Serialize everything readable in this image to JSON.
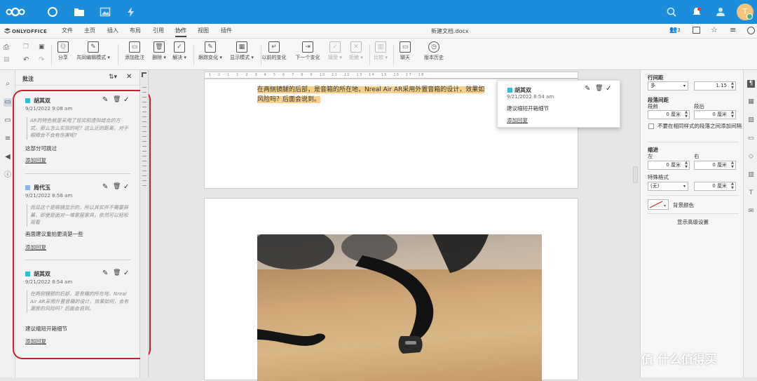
{
  "nextcloud": {
    "icons": [
      "nextcloud-logo",
      "dashboard-icon",
      "files-icon",
      "photos-icon",
      "activity-icon",
      "search-icon",
      "notifications-icon",
      "contacts-icon"
    ],
    "avatar_letter": "T"
  },
  "app": {
    "brand": "ONLYOFFICE",
    "doc_title": "新建文档.docx",
    "tabs": [
      "文件",
      "主页",
      "插入",
      "布局",
      "引用",
      "协作",
      "视图",
      "插件"
    ],
    "active_tab": "协作",
    "header_right": {
      "users_count": "3"
    }
  },
  "toolbar": {
    "share": "分享",
    "coedit": "共同编辑模式",
    "add_comment": "添加批注",
    "delete": "删除",
    "resolve": "解决",
    "track_changes": "跟踪变化",
    "display_mode": "显示模式",
    "prev_change": "以前的变化",
    "next_change": "下一个变化",
    "accept": "接受",
    "reject": "拒绝",
    "compare": "比较",
    "chat": "聊天",
    "version_history": "版本历史"
  },
  "comments_panel": {
    "title": "批注",
    "comments": [
      {
        "author": "胡其双",
        "date": "9/21/2022 9:08 am",
        "color": "#2cc0d0",
        "quote": "AR的特色就是采用了现实和虚拟结合的方式。那么怎么实现的呢？这么近的距离，对于眼睛会不会有伤害呢?",
        "text": "这部分可跳过",
        "reply": "添加回复"
      },
      {
        "author": "周代玉",
        "date": "9/21/2022 8:58 am",
        "color": "#8ab8e6",
        "quote": "而且这个是眼镜显示的，所以其实并不需要屏幕，即使是面对一堆家居家具，依然可以轻松观看",
        "text": "画面建议重拍更清楚一些",
        "reply": "添加回复"
      },
      {
        "author": "胡其双",
        "date": "9/21/2022 8:54 am",
        "color": "#2cc0d0",
        "quote": "在两侧镜腿的后部，是音箱的所在地，Nreal Air AR采用外置音箱的设计，效果如何，会有漏音的风险吗？后面会说到。",
        "text": "建议缩短开箱细节",
        "reply": "添加回复"
      }
    ]
  },
  "document": {
    "highlight_line1": "在两侧镜腿的后部，是音箱的所在地，Nreal Air AR采用外置音箱的设计，效果如",
    "highlight_line2": "风险吗？后面会说到。",
    "ruler": "· 1 · 2 · 1 · 1 · 2 · 3 · 4 · 5 · 6 · 7 · 8 · 9 · 10 · 11 · 12 · 13 · 14 · 15 · 16 · 17 · 18 ·"
  },
  "popup": {
    "author": "胡其双",
    "date": "9/21/2022 8:54 am",
    "text": "建议缩短开箱细节",
    "reply": "添加回复"
  },
  "paragraph_panel": {
    "line_spacing_label": "行间距",
    "line_spacing_mode": "多",
    "line_spacing_value": "1.15",
    "para_spacing_label": "段落间距",
    "before_label": "段前",
    "after_label": "段后",
    "before_value": "0 厘米",
    "after_value": "0 厘米",
    "no_space_same_style": "不要在相同样式的段落之间添加间隔",
    "indent_label": "缩进",
    "left_label": "左",
    "right_label": "右",
    "left_value": "0 厘米",
    "right_value": "0 厘米",
    "special_label": "特殊格式",
    "special_value": "(无)",
    "special_amount": "0 厘米",
    "bg_color_label": "背景颜色",
    "advanced_link": "显示高级设置"
  },
  "watermark": "值 什么值得买"
}
